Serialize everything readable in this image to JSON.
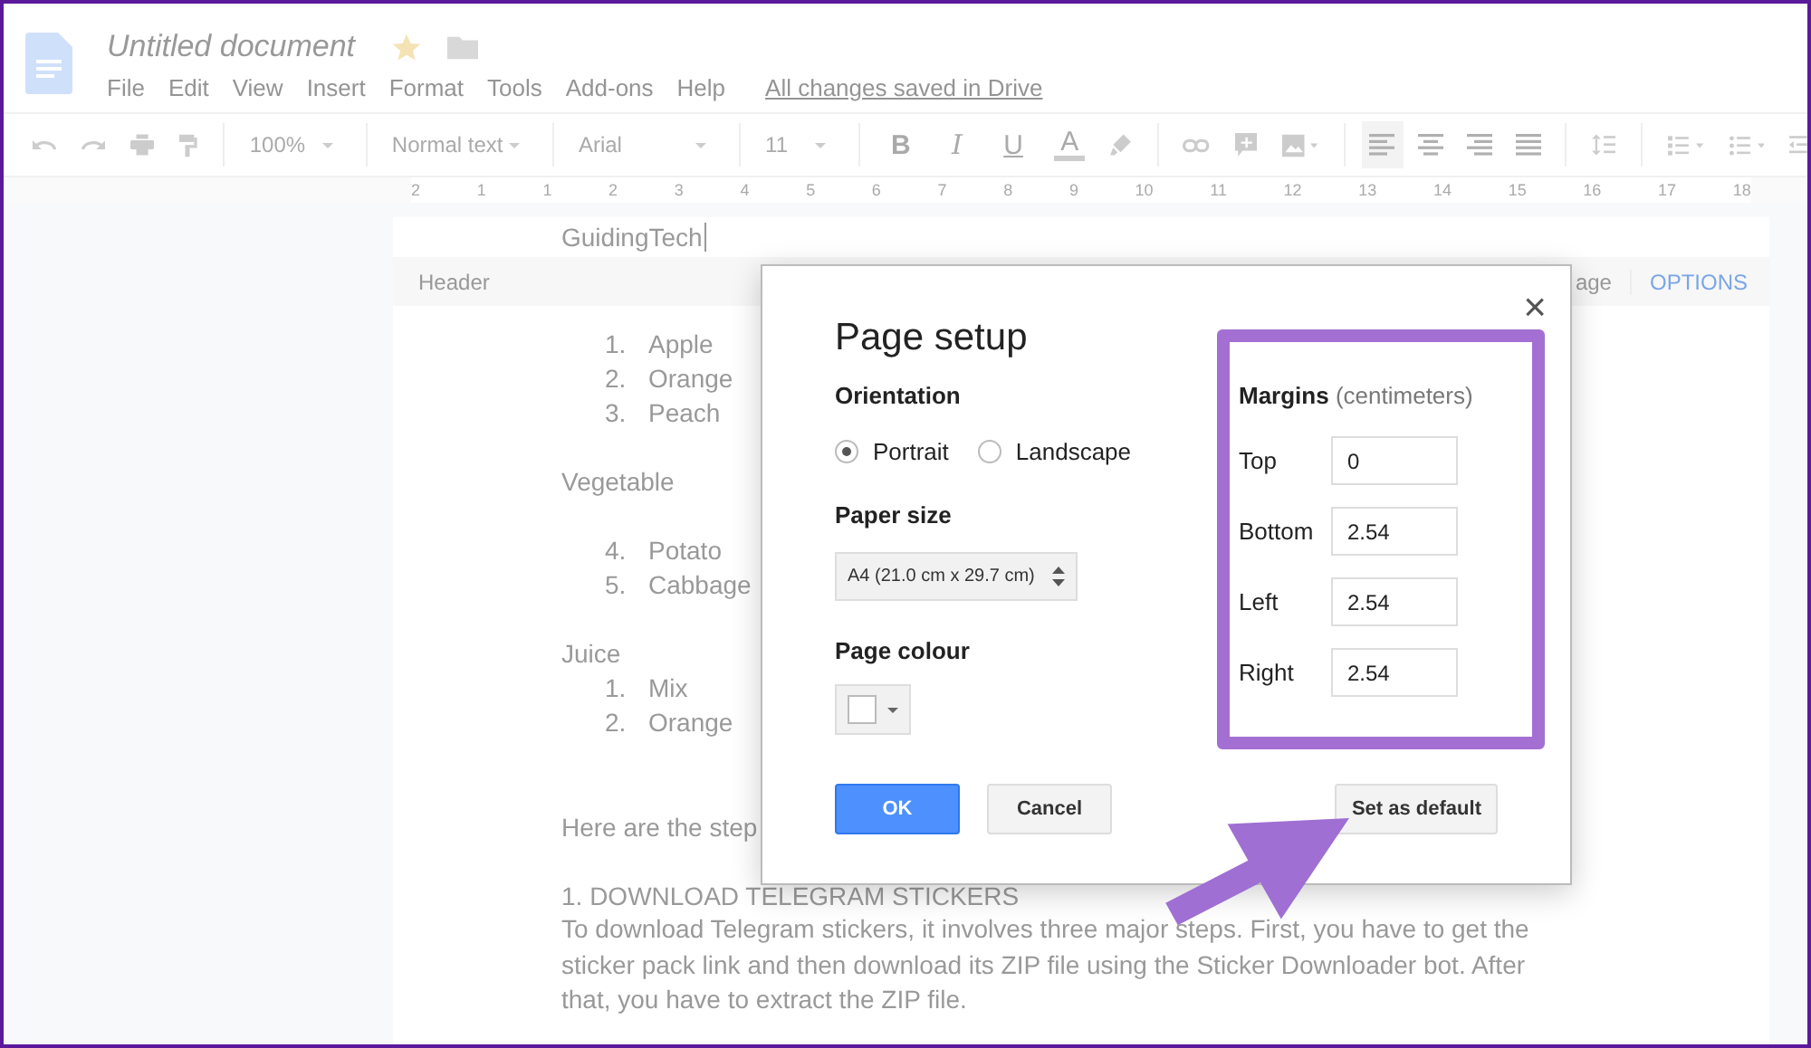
{
  "app": {
    "title": "Untitled document",
    "starred": true,
    "menu": [
      "File",
      "Edit",
      "View",
      "Insert",
      "Format",
      "Tools",
      "Add-ons",
      "Help"
    ],
    "save_status": "All changes saved in Drive"
  },
  "toolbar": {
    "zoom": "100%",
    "style": "Normal text",
    "font": "Arial",
    "size": "11",
    "format_buttons": [
      "B",
      "I",
      "U",
      "A"
    ],
    "align_buttons": [
      {
        "selected": true
      },
      {
        "selected": false
      },
      {
        "selected": false
      },
      {
        "selected": false
      }
    ]
  },
  "ruler": {
    "labels": [
      "2",
      "1",
      "1",
      "2",
      "3",
      "4",
      "5",
      "6",
      "7",
      "8",
      "9",
      "10",
      "11",
      "12",
      "13",
      "14",
      "15",
      "16",
      "17",
      "18"
    ]
  },
  "document": {
    "header_text": "GuidingTech",
    "header_bar": {
      "label": "Header",
      "page_option": "age",
      "options": "OPTIONS"
    },
    "sections": [
      {
        "lines": [
          {
            "number": "1.",
            "text": "Apple"
          },
          {
            "number": "2.",
            "text": "Orange"
          },
          {
            "number": "3.",
            "text": "Peach"
          }
        ]
      },
      {
        "lines": [
          {
            "text": "Vegetable"
          }
        ]
      },
      {
        "lines": [
          {
            "number": "4.",
            "text": "Potato"
          },
          {
            "number": "5.",
            "text": "Cabbage"
          }
        ]
      },
      {
        "lines": [
          {
            "text": "Juice"
          },
          {
            "number": "1.",
            "text": "Mix"
          },
          {
            "number": "2.",
            "text": "Orange"
          }
        ]
      }
    ],
    "intro": "Here are the step",
    "heading": "1. DOWNLOAD TELEGRAM STICKERS",
    "paragraph": "To download Telegram stickers, it involves three major steps. First, you have to get the sticker pack link and then download its ZIP file using the Sticker Downloader bot. After that, you have to extract the ZIP file."
  },
  "dialog": {
    "title": "Page setup",
    "close": "×",
    "orientation": {
      "label": "Orientation",
      "options": [
        {
          "label": "Portrait",
          "selected": true
        },
        {
          "label": "Landscape",
          "selected": false
        }
      ]
    },
    "paper_size": {
      "label": "Paper size",
      "value": "A4 (21.0 cm x 29.7 cm)"
    },
    "page_colour": {
      "label": "Page colour",
      "color": "#ffffff"
    },
    "margins": {
      "label": "Margins",
      "unit": "(centimeters)",
      "fields": [
        {
          "label": "Top",
          "value": "0"
        },
        {
          "label": "Bottom",
          "value": "2.54"
        },
        {
          "label": "Left",
          "value": "2.54"
        },
        {
          "label": "Right",
          "value": "2.54"
        }
      ]
    },
    "buttons": [
      {
        "label": "OK",
        "kind": "primary"
      },
      {
        "label": "Cancel",
        "kind": "secondary"
      },
      {
        "label": "Set as default",
        "kind": "secondary"
      }
    ]
  }
}
